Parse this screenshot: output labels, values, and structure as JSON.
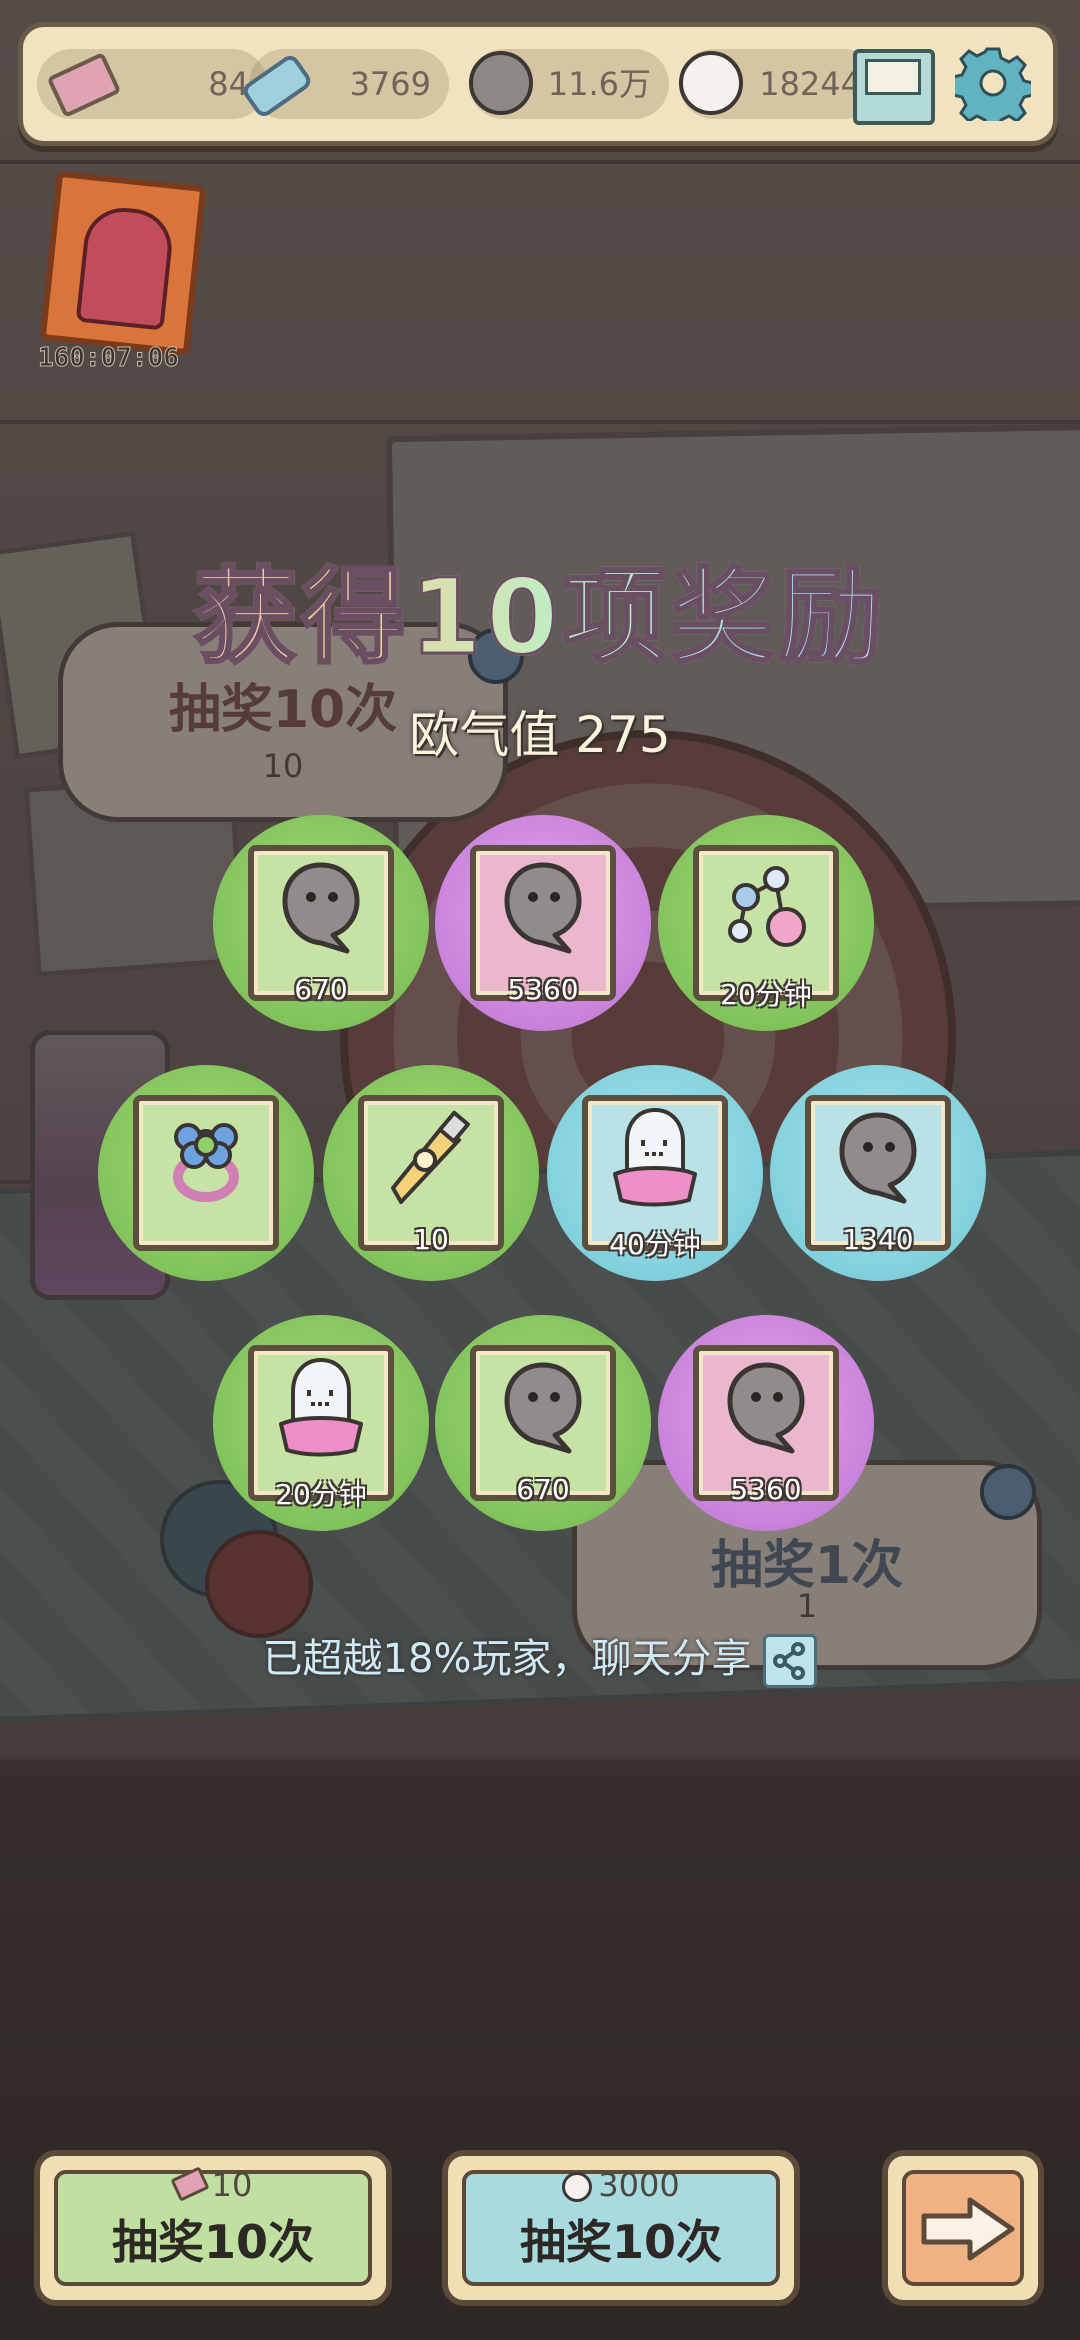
{
  "resources": {
    "tickets": "84",
    "candy": "3769",
    "ghost_dark": "11.6万",
    "ghost_light": "18244"
  },
  "event": {
    "timer": "160:07:06"
  },
  "background": {
    "draw10_label": "抽奖10次",
    "draw10_cost": "10",
    "draw1_label": "抽奖1次",
    "draw1_cost": "1"
  },
  "result": {
    "title": "获得10项奖励",
    "luck_label": "欧气值 275",
    "share_text": "已超越18%玩家，聊天分享"
  },
  "rewards": [
    {
      "icon": "dark-ghost-blob-icon",
      "count": "670",
      "rarity": "green"
    },
    {
      "icon": "dark-ghost-blob-icon",
      "count": "5360",
      "rarity": "purple"
    },
    {
      "icon": "molecule-potion-icon",
      "count": "20分钟",
      "rarity": "green"
    },
    {
      "icon": "flower-ring-icon",
      "count": "",
      "rarity": "green"
    },
    {
      "icon": "glue-tube-icon",
      "count": "10",
      "rarity": "green"
    },
    {
      "icon": "ghost-with-cloth-icon",
      "count": "40分钟",
      "rarity": "teal"
    },
    {
      "icon": "dark-ghost-blob-icon",
      "count": "1340",
      "rarity": "teal"
    },
    {
      "icon": "ghost-with-cloth-icon",
      "count": "20分钟",
      "rarity": "green"
    },
    {
      "icon": "dark-ghost-blob-icon",
      "count": "670",
      "rarity": "green"
    },
    {
      "icon": "dark-ghost-blob-icon",
      "count": "5360",
      "rarity": "purple"
    }
  ],
  "buttons": {
    "draw_ticket": {
      "cost": "10",
      "label": "抽奖10次"
    },
    "draw_ghost": {
      "cost": "3000",
      "label": "抽奖10次"
    }
  },
  "colors": {
    "green": "#82c35b",
    "purple": "#c982da",
    "teal": "#82d0dc",
    "btn_green": "#bfe0a0",
    "btn_teal": "#a7dbe0",
    "btn_orange": "#f0b183"
  }
}
